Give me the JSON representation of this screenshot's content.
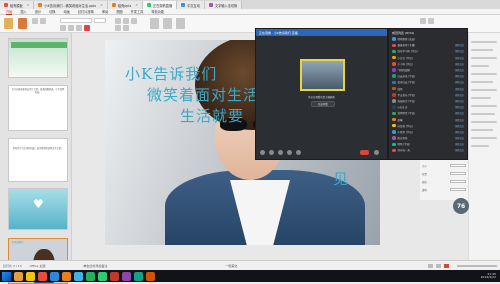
{
  "tabs": [
    {
      "label": "稻壳模板",
      "color": "#e74c3c"
    },
    {
      "label": "小K告诉我们…微笑着面对生活.pptx",
      "color": "#e67e22"
    },
    {
      "label": "稻壳pptx",
      "color": "#e67e22"
    },
    {
      "label": "正在观看直播",
      "color": "#2ecc71",
      "active": true
    },
    {
      "label": "中文互动",
      "color": "#3498db"
    },
    {
      "label": "文字输入法切换",
      "color": "#9b59b6"
    }
  ],
  "menu": [
    "开始",
    "插入",
    "设计",
    "切换",
    "动画",
    "幻灯片放映",
    "审阅",
    "视图",
    "开发工具",
    "特色功能"
  ],
  "slide_numbers": [
    "1",
    "2",
    "3",
    "4",
    "5",
    "6"
  ],
  "thumb_text": {
    "t2": "文字内容较多的幻灯片示意，段落排版列表，小字说明内容。",
    "t3": "带有若干行文本的页面，居中排列的说明文字示意。",
    "t5": "小K告诉我们"
  },
  "slide": {
    "line1": "小K告诉我们",
    "line2": "微笑着面对生活",
    "line3": "生活就要",
    "line4": "见"
  },
  "video": {
    "title": "正在观看 · 小K告诉我们 直播",
    "caption": "你正在观看的是主播屏幕",
    "exit_label": "结束观看"
  },
  "chat": {
    "header": "成员列表 (8/34)",
    "members": [
      {
        "name": "晴雨霏霏 (成员)",
        "color": "#4a90d9",
        "action": ""
      },
      {
        "name": "嘉嘉老师 (主播)",
        "color": "#e74c3c",
        "action": "删除成员"
      },
      {
        "name": "快乐学习中 (学员)",
        "color": "#27ae60",
        "action": "删除成员"
      },
      {
        "name": "小豆豆 (学员)",
        "color": "#f39c12",
        "action": "删除成员"
      },
      {
        "name": "小小鱼 (学员)",
        "color": "#e74c3c",
        "action": "删除成员"
      },
      {
        "name": "飞翔的翅膀",
        "color": "#8e44ad",
        "action": "删除成员"
      },
      {
        "name": "白云朵朵 (学员)",
        "color": "#16a085",
        "action": "删除成员"
      },
      {
        "name": "蓝天白云 (学员)",
        "color": "#2980b9",
        "action": "删除成员"
      },
      {
        "name": "微风",
        "color": "#d35400",
        "action": "删除成员"
      },
      {
        "name": "平安喜乐 (学员)",
        "color": "#c0392b",
        "action": "删除成员"
      },
      {
        "name": "海阔天空 (学员)",
        "color": "#7f8c8d",
        "action": "删除成员"
      },
      {
        "name": "心如止水",
        "color": "#2c3e50",
        "action": "删除成员"
      },
      {
        "name": "清风明月 (学员)",
        "color": "#27ae60",
        "action": "删除成员"
      },
      {
        "name": "晨曦",
        "color": "#e67e22",
        "action": "删除成员"
      },
      {
        "name": "向日葵 (学员)",
        "color": "#f1c40f",
        "action": "删除成员"
      },
      {
        "name": "小星星 (学员)",
        "color": "#3498db",
        "action": "删除成员"
      },
      {
        "name": "阳光男孩",
        "color": "#9b59b6",
        "action": "删除成员"
      },
      {
        "name": "晚风 (学员)",
        "color": "#1abc9c",
        "action": "删除成员"
      },
      {
        "name": "快乐每一天",
        "color": "#e74c3c",
        "action": "删除成员"
      }
    ]
  },
  "props": [
    {
      "label": "大小",
      "value": ""
    },
    {
      "label": "位置",
      "value": ""
    },
    {
      "label": "旋转",
      "value": ""
    },
    {
      "label": "透明",
      "value": ""
    }
  ],
  "badge": "76",
  "status": {
    "slide_info": "幻灯片 3 / 13",
    "theme": "Office 主题",
    "notes": "单击此处添加备注",
    "zoom": "一键美化"
  },
  "clock": {
    "time": "21:45",
    "date": "2016/4/22"
  }
}
